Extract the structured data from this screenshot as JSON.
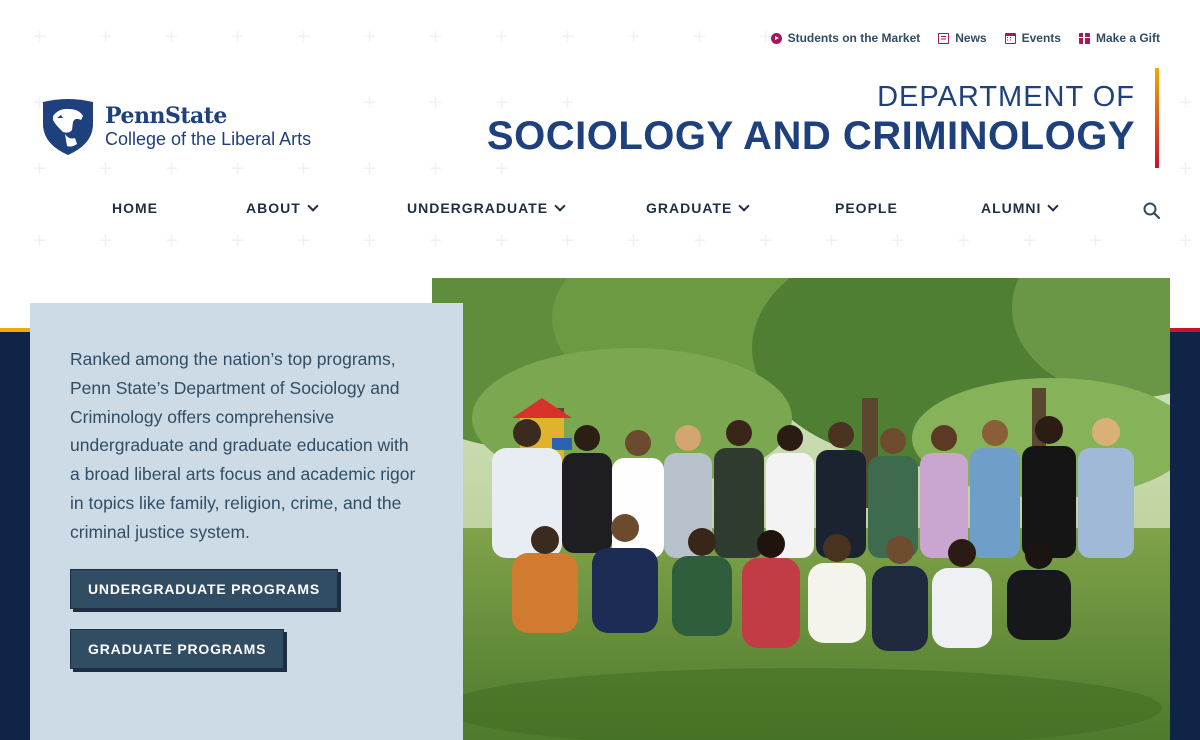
{
  "utility_nav": [
    {
      "label": "Students on the Market",
      "icon": "circle-arrow-icon"
    },
    {
      "label": "News",
      "icon": "newspaper-icon"
    },
    {
      "label": "Events",
      "icon": "calendar-icon"
    },
    {
      "label": "Make a Gift",
      "icon": "gift-icon"
    }
  ],
  "logo": {
    "brand": "PennState",
    "college": "College of the Liberal Arts"
  },
  "department": {
    "line1": "DEPARTMENT OF",
    "line2": "SOCIOLOGY AND CRIMINOLOGY"
  },
  "main_nav": [
    {
      "label": "HOME",
      "has_dropdown": false
    },
    {
      "label": "ABOUT",
      "has_dropdown": true
    },
    {
      "label": "UNDERGRADUATE",
      "has_dropdown": true
    },
    {
      "label": "GRADUATE",
      "has_dropdown": true
    },
    {
      "label": "PEOPLE",
      "has_dropdown": false
    },
    {
      "label": "ALUMNI",
      "has_dropdown": true
    }
  ],
  "hero": {
    "text": "Ranked among the nation’s top programs, Penn State’s Department of Sociology and Criminology offers comprehensive undergraduate and graduate education with a broad liberal arts focus and academic rigor in topics like family, religion, crime, and the criminal justice system.",
    "buttons": [
      "UNDERGRADUATE PROGRAMS",
      "GRADUATE PROGRAMS"
    ]
  },
  "colors": {
    "navy": "#1e407c",
    "dark_navy": "#0f2447",
    "accent": "#a2185b",
    "card_bg": "#cddbe6",
    "button_bg": "#314d64"
  }
}
